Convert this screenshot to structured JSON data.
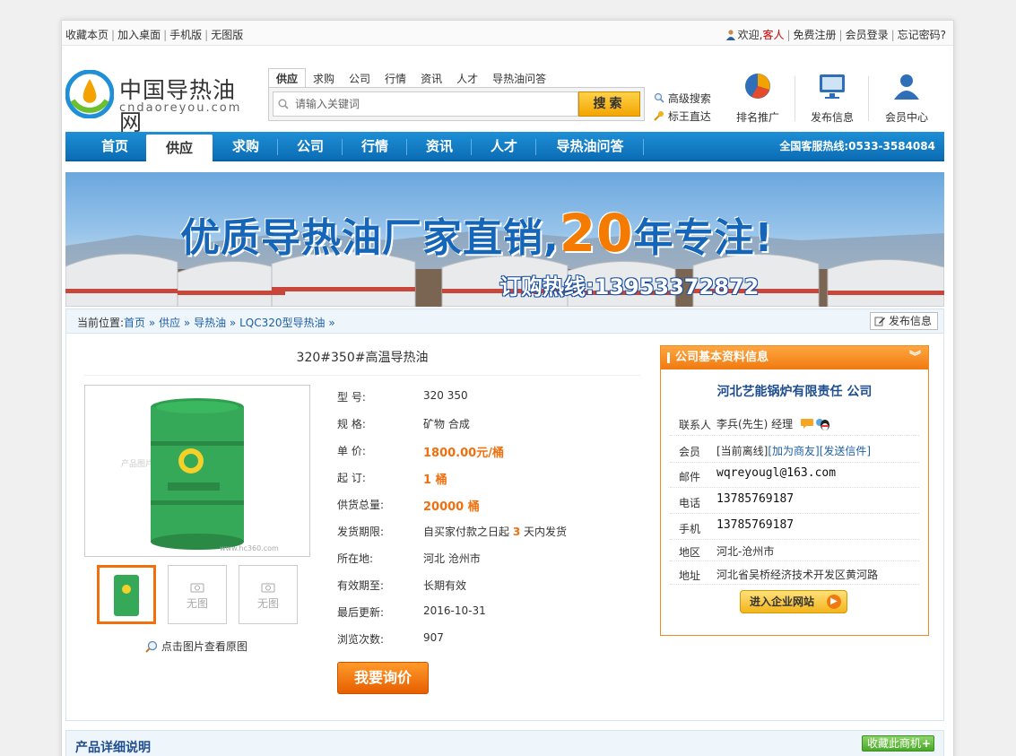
{
  "topbar": {
    "links": [
      "收藏本页",
      "加入桌面",
      "手机版",
      "无图版"
    ],
    "welcome": "欢迎,",
    "guest": "客人",
    "register": "免费注册",
    "login": "会员登录",
    "forgot": "忘记密码?"
  },
  "logo": {
    "name": "中国导热油网",
    "domain": "cndaoreyou.com"
  },
  "search": {
    "tabs": [
      "供应",
      "求购",
      "公司",
      "行情",
      "资讯",
      "人才",
      "导热油问答"
    ],
    "active_tab": "供应",
    "placeholder": "请输入关键词",
    "button": "搜索",
    "advanced": "高级搜索",
    "direct": "标王直达"
  },
  "quick": [
    {
      "label": "排名推广",
      "icon": "pie-chart-icon"
    },
    {
      "label": "发布信息",
      "icon": "monitor-icon"
    },
    {
      "label": "会员中心",
      "icon": "user-icon"
    }
  ],
  "nav": {
    "items": [
      "首页",
      "供应",
      "求购",
      "公司",
      "行情",
      "资讯",
      "人才",
      "导热油问答"
    ],
    "active": "供应",
    "hotline": "全国客服热线:0533-3584084"
  },
  "banner": {
    "title_prefix": "优质导热油厂家直销,",
    "title_number": "20",
    "title_suffix": "年专注!",
    "hotline": "订购热线:13953372872"
  },
  "breadcrumb": {
    "label": "当前位置:",
    "items": [
      "首页",
      "供应",
      "导热油",
      "LQC320型导热油"
    ],
    "sep": "»",
    "publish": "发布信息"
  },
  "product": {
    "title": "320#350#高温导热油",
    "view_original": "点击图片查看原图",
    "no_image": "无图",
    "inquiry_button": "我要询价",
    "specs": [
      {
        "k": "型  号:",
        "v": "320 350"
      },
      {
        "k": "规  格:",
        "v": "矿物 合成"
      },
      {
        "k": "单  价:",
        "v": "1800.00元/桶"
      },
      {
        "k": "起  订:",
        "v": "1 桶"
      },
      {
        "k": "供货总量:",
        "v": "20000 桶"
      },
      {
        "k": "发货期限:",
        "v_pre": "自买家付款之日起 ",
        "v_num": "3",
        "v_post": " 天内发货"
      },
      {
        "k": "所在地:",
        "v": "河北 沧州市"
      },
      {
        "k": "有效期至:",
        "v": "长期有效"
      },
      {
        "k": "最后更新:",
        "v": "2016-10-31"
      },
      {
        "k": "浏览次数:",
        "v": "907"
      }
    ]
  },
  "company": {
    "header": "公司基本资料信息",
    "name": "河北艺能锅炉有限责任 公司",
    "contact_label": "联系人",
    "contact": "李兵(先生) 经理",
    "member_label": "会员",
    "member_status": "[当前离线]",
    "add_friend": "[加为商友]",
    "send_mail": "[发送信件]",
    "email_label": "邮件",
    "email": "wqreyougl@163.com",
    "phone_label": "电话",
    "phone": "13785769187",
    "mobile_label": "手机",
    "mobile": "13785769187",
    "region_label": "地区",
    "region": "河北-沧州市",
    "address_label": "地址",
    "address": "河北省吴桥经济技术开发区黄河路",
    "enter_site": "进入企业网站"
  },
  "detail": {
    "title": "产品详细说明",
    "favorite": "收藏此商机"
  }
}
